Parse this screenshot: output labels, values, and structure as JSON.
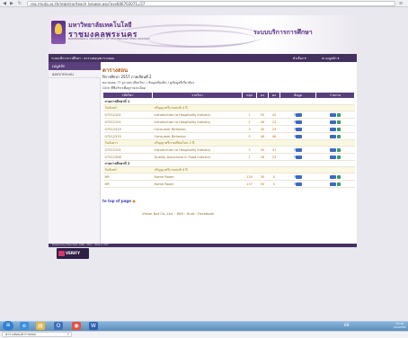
{
  "browser": {
    "url": "reg.rmutp.ac.th/registrar/teach_browse.asp?avs846703071=57",
    "tab_title": "ตารางสอน/ตารางสอบ"
  },
  "header": {
    "uni_thai_line1": "มหาวิทยาลัยเทคโนโลยี",
    "uni_thai_line2": "ราชมงคลพระนคร",
    "uni_en": "RAJAMANGALA UNIVERSITY OF TECHNOLOGY PHRA NAKHON",
    "service_name": "ระบบบริการการศึกษา"
  },
  "navbar": {
    "left_info": "ระบบบริการการศึกษา : ตารางสอน/ตารางสอบ",
    "menu_label": "ตัวเลือก ▾",
    "user_label": "≡ เมนูหลัก ▾"
  },
  "leftnav": {
    "items": [
      "เมนูหลัก",
      "ออกจากระบบ"
    ],
    "badge": "VERIFY",
    "footer": "Powered by Vision Net, 1999 - 2017 · Version 4.67"
  },
  "main": {
    "title": "ตารางสอน",
    "semester": "ปีการศึกษา 2557 ภาคเรียนที่ 2",
    "legend": "หมายเหตุ: ?? ดูรายละเอียดวิชา / ข้อมูลเพิ่มเติม / ดูข้อมูลที่เกี่ยวข้อง",
    "click_note": "Click ที่ชื่อวิชาเพื่อดูรายละเอียด",
    "headers": [
      "รหัสวิชา",
      "รายวิชา",
      "กลุ่ม",
      "ลง",
      "คง",
      "ข้อมูล",
      "รายงาน"
    ],
    "sections": [
      {
        "title": "ภาคการศึกษาที่ 1",
        "days": [
          {
            "label": "วันจันทร์",
            "room": "ปริญญาตรีภาคปกติ 4 ปี",
            "rows": [
              {
                "code": "07512101",
                "name": "Introduction to Hospitality Industry",
                "group": "1",
                "reg": "55",
                "remain": "45"
              },
              {
                "code": "07512101",
                "name": "Introduction to Hospitality Industry",
                "group": "2",
                "reg": "48",
                "remain": "23"
              },
              {
                "code": "07512315",
                "name": "Consumer Behavior",
                "group": "3",
                "reg": "40",
                "remain": "23"
              },
              {
                "code": "07512315",
                "name": "Consumer Behavior",
                "group": "5",
                "reg": "46",
                "remain": "46"
              }
            ]
          },
          {
            "label": "วันอังคาร",
            "room": "ปริญญาตรีภาคเทียบโอน 2 ปี",
            "rows": [
              {
                "code": "07512101",
                "name": "Introduction to Hospitality Industry",
                "group": "3",
                "reg": "50",
                "remain": "41"
              },
              {
                "code": "07512306",
                "name": "Quality Assurance in Food Industry",
                "group": "1",
                "reg": "28",
                "remain": "23"
              }
            ]
          }
        ]
      },
      {
        "title": "ภาคการศึกษาที่ 2",
        "days": [
          {
            "label": "วันจันทร์",
            "room": "ปริญญาตรีภาคปกติ 4 ปี",
            "rows": [
              {
                "code": "HR",
                "name": "Home Room",
                "group": "130",
                "reg": "30",
                "remain": "0"
              },
              {
                "code": "HR",
                "name": "Home Room",
                "group": "137",
                "reg": "50",
                "remain": "0"
              }
            ]
          }
        ]
      }
    ],
    "top_link": "to top of page",
    "footer": "Vision Net Co.,Ltd. : Wifi : Hunt : Facebook"
  },
  "taskbar": {
    "tray": "EN",
    "time": "10:18",
    "date": "2/2/2558"
  },
  "colors": {
    "accent": "#5a3f7d",
    "title": "#b15b16",
    "row_text": "#8a6b2a",
    "day_bg": "#fbf8e2"
  }
}
